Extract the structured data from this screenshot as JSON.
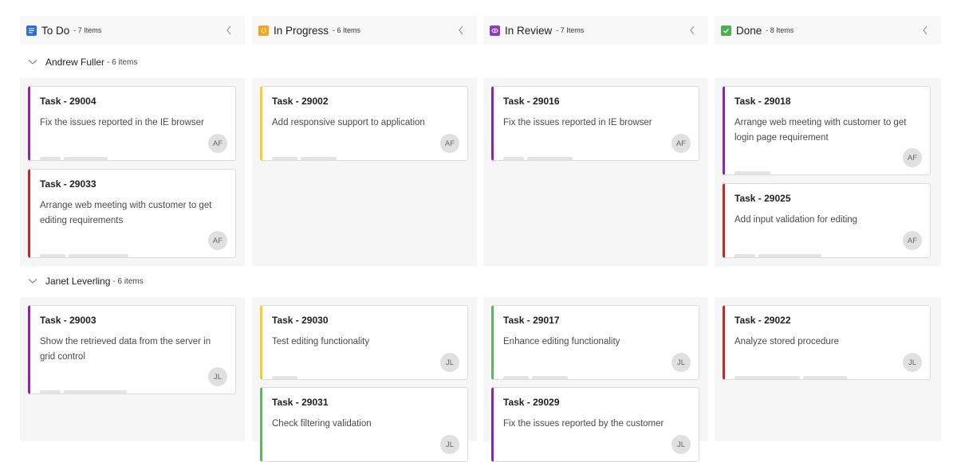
{
  "columns": [
    {
      "title": "To Do",
      "count": "- 7 Items",
      "icon": "list-icon",
      "color": "#2b6fd6"
    },
    {
      "title": "In Progress",
      "count": "- 6 Items",
      "icon": "progress-icon",
      "color": "#f4a623"
    },
    {
      "title": "In Review",
      "count": "- 7 Items",
      "icon": "review-icon",
      "color": "#8e3bbf"
    },
    {
      "title": "Done",
      "count": "- 8 Items",
      "icon": "check-icon",
      "color": "#4caf50"
    }
  ],
  "swimlanes": [
    {
      "name": "Andrew Fuller",
      "count": "- 6 items"
    },
    {
      "name": "Janet Leverling",
      "count": "- 6 items"
    }
  ],
  "cards": [
    {
      "title": "Task - 29004",
      "desc": "Fix the issues reported in the IE browser",
      "avatar": "AF",
      "color": "#8e24aa"
    },
    {
      "title": "Task - 29033",
      "desc": "Arrange web meeting with customer to get editing requirements",
      "avatar": "AF",
      "color": "#c62828"
    },
    {
      "title": "Task - 29002",
      "desc": "Add responsive support to application",
      "avatar": "AF",
      "color": "#f2d028"
    },
    {
      "title": "Task - 29016",
      "desc": "Fix the issues reported in IE browser",
      "avatar": "AF",
      "color": "#8e24aa"
    },
    {
      "title": "Task - 29018",
      "desc": "Arrange web meeting with customer to get login page requirement",
      "avatar": "AF",
      "color": "#8e24aa"
    },
    {
      "title": "Task - 29025",
      "desc": "Add input validation for editing",
      "avatar": "AF",
      "color": "#c62828"
    },
    {
      "title": "Task - 29003",
      "desc": "Show the retrieved data from the server in grid control",
      "avatar": "JL",
      "color": "#8e24aa"
    },
    {
      "title": "Task - 29030",
      "desc": "Test editing functionality",
      "avatar": "JL",
      "color": "#f2d028"
    },
    {
      "title": "Task - 29031",
      "desc": "Check filtering validation",
      "avatar": "JL",
      "color": "#5cb85c"
    },
    {
      "title": "Task - 29017",
      "desc": "Enhance editing functionality",
      "avatar": "JL",
      "color": "#5cb85c"
    },
    {
      "title": "Task - 29029",
      "desc": "Fix the issues reported by the customer",
      "avatar": "JL",
      "color": "#8e24aa"
    },
    {
      "title": "Task - 29022",
      "desc": "Analyze stored procedure",
      "avatar": "JL",
      "color": "#c62828"
    }
  ]
}
